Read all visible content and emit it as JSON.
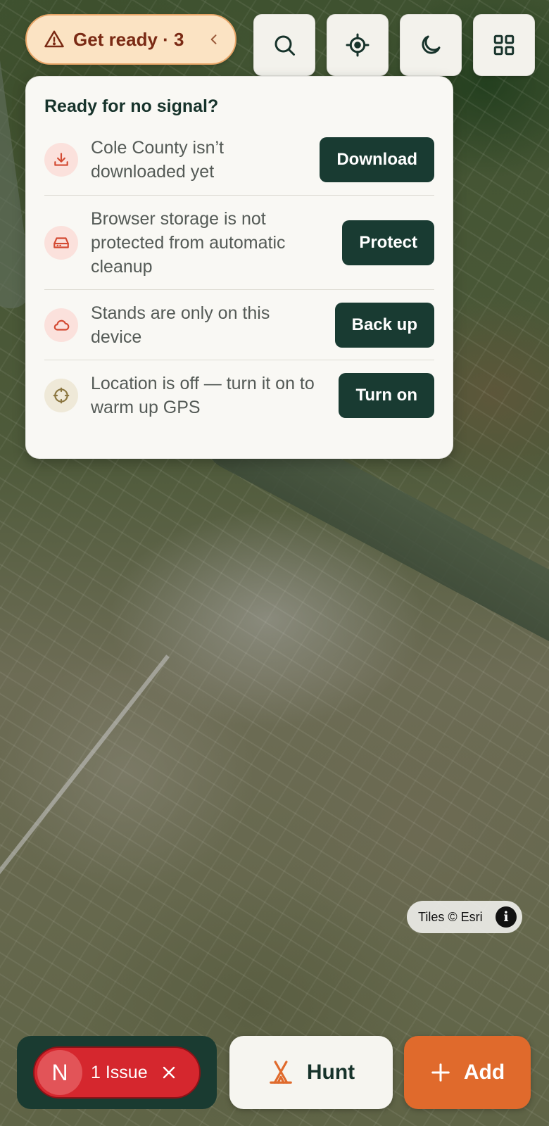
{
  "map": {
    "attribution": "Tiles © Esri",
    "info_icon": "info-icon"
  },
  "toolbar": {
    "ready_label": "Get ready · 3",
    "icons": [
      "search-icon",
      "locate-icon",
      "night-mode-icon",
      "grid-icon"
    ]
  },
  "panel": {
    "title": "Ready for no signal?",
    "items": [
      {
        "icon": "download-icon",
        "text": "Cole County isn’t downloaded yet",
        "action": "Download"
      },
      {
        "icon": "storage-icon",
        "text": "Browser storage is not protected from automatic cleanup",
        "action": "Protect"
      },
      {
        "icon": "cloud-icon",
        "text": "Stands are only on this device",
        "action": "Back up"
      },
      {
        "icon": "gps-icon",
        "text": "Location is off — turn it on to warm up GPS",
        "action": "Turn on"
      }
    ]
  },
  "bottom": {
    "issue_avatar": "N",
    "issue_label": "1 Issue",
    "hunt_label": "Hunt",
    "add_label": "Add"
  },
  "colors": {
    "primary_dark": "#193b32",
    "warning_bg": "#fbe3c3",
    "warning_text": "#7a2a14",
    "issue_red": "#d5272e",
    "add_orange": "#e06a2c"
  }
}
